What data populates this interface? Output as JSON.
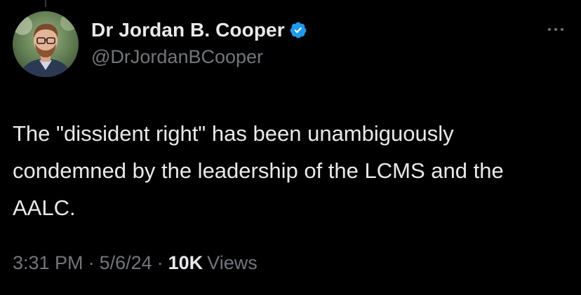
{
  "tweet": {
    "author": {
      "display_name": "Dr Jordan B. Cooper",
      "handle": "@DrJordanBCooper",
      "verified": true,
      "verified_color": "#1d9bf0",
      "avatar_icon": "profile-photo"
    },
    "text": "The \"dissident right\" has been unambiguously condemned by the leadership of the LCMS and the AALC.",
    "time": "3:31 PM",
    "separator": "·",
    "date": "5/6/24",
    "views_count": "10K",
    "views_label": "Views",
    "more_icon": "more-horizontal-icon"
  },
  "colors": {
    "background": "#000000",
    "primary_text": "#e7e9ea",
    "secondary_text": "#71767b",
    "accent": "#1d9bf0"
  }
}
